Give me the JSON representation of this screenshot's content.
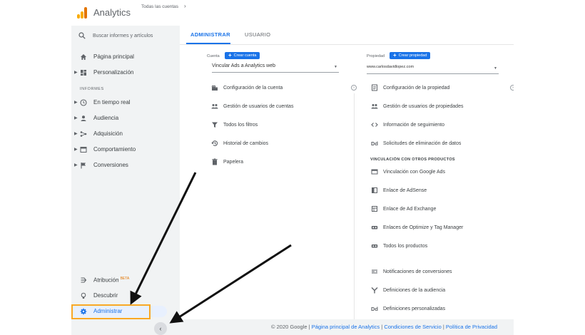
{
  "app": {
    "title": "Analytics",
    "breadcrumb": "Todas las cuentas",
    "breadcrumb_arrow": "›"
  },
  "sidebar": {
    "search_placeholder": "Buscar informes y artículos",
    "home": "Página principal",
    "customization": "Personalización",
    "section_reports": "INFORMES",
    "realtime": "En tiempo real",
    "audience": "Audiencia",
    "acquisition": "Adquisición",
    "behavior": "Comportamiento",
    "conversions": "Conversiones",
    "attribution": "Atribución",
    "attribution_badge": "BETA",
    "discover": "Descubrir",
    "admin": "Administrar",
    "collapse": "‹"
  },
  "tabs": {
    "admin": "ADMINISTRAR",
    "user": "USUARIO"
  },
  "account": {
    "label": "Cuenta",
    "create_button": "Crear cuenta",
    "selected": "Vincular Ads a Analytics web",
    "items": [
      "Configuración de la cuenta",
      "Gestión de usuarios de cuentas",
      "Todos los filtros",
      "Historial de cambios",
      "Papelera"
    ]
  },
  "property": {
    "label": "Propiedad",
    "create_button": "Crear propiedad",
    "selected": "www.carlosdavidlopez.com",
    "items": [
      "Configuración de la propiedad",
      "Gestión de usuarios de propiedades",
      "Información de seguimiento",
      "Solicitudes de eliminación de datos"
    ],
    "linking_heading": "VINCULACIÓN CON OTROS PRODUCTOS",
    "linking_items": [
      "Vinculación con Google Ads",
      "Enlace de AdSense",
      "Enlace de Ad Exchange",
      "Enlaces de Optimize y Tag Manager",
      "Todos los productos"
    ],
    "more_items": [
      "Notificaciones de conversiones",
      "Definiciones de la audiencia",
      "Definiciones personalizadas"
    ]
  },
  "footer": {
    "copyright": "© 2020 Google",
    "sep": " | ",
    "home_link": "Página principal de Analytics",
    "terms_link": "Condiciones de Servicio",
    "privacy_link": "Política de Privacidad"
  },
  "colors": {
    "accent": "#1a73e8",
    "highlight": "#f9a825",
    "sidebar_bg": "#f1f3f4"
  }
}
